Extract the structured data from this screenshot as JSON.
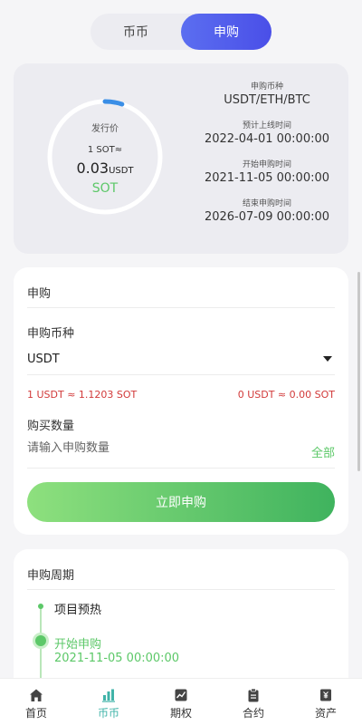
{
  "tabs": [
    {
      "label": "币币",
      "active": false
    },
    {
      "label": "申购",
      "active": true
    }
  ],
  "info": {
    "issue_price_label": "发行价",
    "rate_line": "1 SOT≈",
    "price_value": "0.03",
    "price_unit": "USDT",
    "coin": "SOT",
    "ring_progress": 0.05,
    "fields": [
      {
        "label": "申购币种",
        "value": "USDT/ETH/BTC"
      },
      {
        "label": "预计上线时间",
        "value": "2022-04-01 00:00:00"
      },
      {
        "label": "开始申购时间",
        "value": "2021-11-05 00:00:00"
      },
      {
        "label": "结束申购时间",
        "value": "2026-07-09 00:00:00"
      }
    ]
  },
  "subscribe": {
    "title": "申购",
    "currency_label": "申购币种",
    "currency_value": "USDT",
    "rate_left": "1 USDT ≈ 1.1203 SOT",
    "rate_right": "0 USDT ≈ 0.00 SOT",
    "quantity_label": "购买数量",
    "quantity_placeholder": "请输入申购数量",
    "all_label": "全部",
    "button_label": "立即申购"
  },
  "period": {
    "title": "申购周期",
    "steps": [
      {
        "label": "项目预热"
      },
      {
        "label": "开始申购",
        "time": "2021-11-05 00:00:00"
      }
    ]
  },
  "nav": [
    {
      "label": "首页",
      "icon": "home-icon",
      "active": false
    },
    {
      "label": "币币",
      "icon": "bar-chart-icon",
      "active": true
    },
    {
      "label": "期权",
      "icon": "trend-chart-icon",
      "active": false
    },
    {
      "label": "合约",
      "icon": "clipboard-icon",
      "active": false
    },
    {
      "label": "资产",
      "icon": "wallet-icon",
      "active": false
    }
  ],
  "colors": {
    "accent_blue": "#4a4fe8",
    "accent_green": "#5cc868",
    "rate_red": "#d23a3a",
    "nav_active": "#3fb3a8"
  }
}
